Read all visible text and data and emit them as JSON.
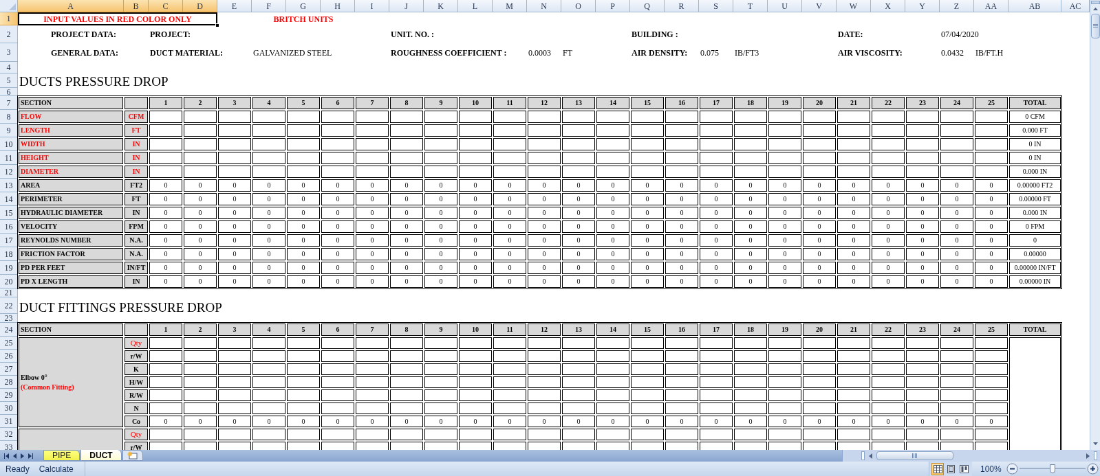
{
  "column_headers": [
    {
      "label": "A",
      "selected": true
    },
    {
      "label": "B",
      "selected": true
    },
    {
      "label": "C",
      "selected": true
    },
    {
      "label": "D",
      "selected": true
    },
    {
      "label": "E",
      "selected": false
    },
    {
      "label": "F",
      "selected": false
    },
    {
      "label": "G",
      "selected": false
    },
    {
      "label": "H",
      "selected": false
    },
    {
      "label": "I",
      "selected": false
    },
    {
      "label": "J",
      "selected": false
    },
    {
      "label": "K",
      "selected": false
    },
    {
      "label": "L",
      "selected": false
    },
    {
      "label": "M",
      "selected": false
    },
    {
      "label": "N",
      "selected": false
    },
    {
      "label": "O",
      "selected": false
    },
    {
      "label": "P",
      "selected": false
    },
    {
      "label": "Q",
      "selected": false
    },
    {
      "label": "R",
      "selected": false
    },
    {
      "label": "S",
      "selected": false
    },
    {
      "label": "T",
      "selected": false
    },
    {
      "label": "U",
      "selected": false
    },
    {
      "label": "V",
      "selected": false
    },
    {
      "label": "W",
      "selected": false
    },
    {
      "label": "X",
      "selected": false
    },
    {
      "label": "Y",
      "selected": false
    },
    {
      "label": "Z",
      "selected": false
    },
    {
      "label": "AA",
      "selected": false
    },
    {
      "label": "AB",
      "selected": false
    },
    {
      "label": "AC",
      "selected": false
    }
  ],
  "row_headers": [
    {
      "label": "1",
      "selected": true
    },
    {
      "label": "2",
      "selected": false
    },
    {
      "label": "3",
      "selected": false
    },
    {
      "label": "4",
      "selected": false
    },
    {
      "label": "5",
      "selected": false
    },
    {
      "label": "6",
      "selected": false
    },
    {
      "label": "7",
      "selected": false
    },
    {
      "label": "8",
      "selected": false
    },
    {
      "label": "9",
      "selected": false
    },
    {
      "label": "10",
      "selected": false
    },
    {
      "label": "11",
      "selected": false
    },
    {
      "label": "12",
      "selected": false
    },
    {
      "label": "13",
      "selected": false
    },
    {
      "label": "14",
      "selected": false
    },
    {
      "label": "15",
      "selected": false
    },
    {
      "label": "16",
      "selected": false
    },
    {
      "label": "17",
      "selected": false
    },
    {
      "label": "18",
      "selected": false
    },
    {
      "label": "19",
      "selected": false
    },
    {
      "label": "20",
      "selected": false
    },
    {
      "label": "21",
      "selected": false
    },
    {
      "label": "22",
      "selected": false
    },
    {
      "label": "23",
      "selected": false
    },
    {
      "label": "24",
      "selected": false
    },
    {
      "label": "25",
      "selected": false
    },
    {
      "label": "26",
      "selected": false
    },
    {
      "label": "27",
      "selected": false
    },
    {
      "label": "28",
      "selected": false
    },
    {
      "label": "29",
      "selected": false
    },
    {
      "label": "30",
      "selected": false
    },
    {
      "label": "31",
      "selected": false
    },
    {
      "label": "32",
      "selected": false
    },
    {
      "label": "33",
      "selected": false
    }
  ],
  "note": "INPUT VALUES IN RED COLOR ONLY",
  "units_label": "BRITCH UNITS",
  "info_rows": [
    {
      "heading": "PROJECT DATA:",
      "fields": [
        {
          "label": "PROJECT:"
        },
        {
          "label": "UNIT. NO. :"
        },
        {
          "label": "BUILDING :"
        },
        {
          "label": "DATE:",
          "value": "07/04/2020"
        }
      ]
    },
    {
      "heading": "GENERAL DATA:",
      "fields": [
        {
          "label": "DUCT MATERIAL:",
          "value": "GALVANIZED STEEL"
        },
        {
          "label": "ROUGHNESS COEFFICIENT :",
          "value": "0.0003",
          "unit": "FT"
        },
        {
          "label": "AIR DENSITY:",
          "value": "0.075",
          "unit": "IB/FT3"
        },
        {
          "label": "AIR VISCOSITY:",
          "value": "0.0432",
          "unit": "IB/FT.H"
        }
      ]
    }
  ],
  "ducts": {
    "title": "DUCTS PRESSURE DROP",
    "section_header": "SECTION",
    "section_numbers": [
      "1",
      "2",
      "3",
      "4",
      "5",
      "6",
      "7",
      "8",
      "9",
      "10",
      "11",
      "12",
      "13",
      "14",
      "15",
      "16",
      "17",
      "18",
      "19",
      "20",
      "21",
      "22",
      "23",
      "24",
      "25"
    ],
    "total_header": "TOTAL",
    "rows": [
      {
        "label": "FLOW",
        "unit": "CFM",
        "kind": "input",
        "total": "0 CFM"
      },
      {
        "label": "LENGTH",
        "unit": "FT",
        "kind": "input",
        "total": "0.000 FT"
      },
      {
        "label": "WIDTH",
        "unit": "IN",
        "kind": "input",
        "total": "0 IN"
      },
      {
        "label": "HEIGHT",
        "unit": "IN",
        "kind": "input",
        "total": "0 IN"
      },
      {
        "label": "DIAMETER",
        "unit": "IN",
        "kind": "input",
        "total": "0.000 IN"
      },
      {
        "label": "AREA",
        "unit": "FT2",
        "kind": "computed",
        "cells": [
          "0",
          "0",
          "0",
          "0",
          "0",
          "0",
          "0",
          "0",
          "0",
          "0",
          "0",
          "0",
          "0",
          "0",
          "0",
          "0",
          "0",
          "0",
          "0",
          "0",
          "0",
          "0",
          "0",
          "0",
          "0"
        ],
        "total": "0.00000 FT2"
      },
      {
        "label": "PERIMETER",
        "unit": "FT",
        "kind": "computed",
        "cells": [
          "0",
          "0",
          "0",
          "0",
          "0",
          "0",
          "0",
          "0",
          "0",
          "0",
          "0",
          "0",
          "0",
          "0",
          "0",
          "0",
          "0",
          "0",
          "0",
          "0",
          "0",
          "0",
          "0",
          "0",
          "0"
        ],
        "total": "0.00000 FT"
      },
      {
        "label": "HYDRAULIC DIAMETER",
        "unit": "IN",
        "kind": "computed",
        "cells": [
          "0",
          "0",
          "0",
          "0",
          "0",
          "0",
          "0",
          "0",
          "0",
          "0",
          "0",
          "0",
          "0",
          "0",
          "0",
          "0",
          "0",
          "0",
          "0",
          "0",
          "0",
          "0",
          "0",
          "0",
          "0"
        ],
        "total": "0.000 IN"
      },
      {
        "label": "VELOCITY",
        "unit": "FPM",
        "kind": "computed",
        "cells": [
          "0",
          "0",
          "0",
          "0",
          "0",
          "0",
          "0",
          "0",
          "0",
          "0",
          "0",
          "0",
          "0",
          "0",
          "0",
          "0",
          "0",
          "0",
          "0",
          "0",
          "0",
          "0",
          "0",
          "0",
          "0"
        ],
        "total": "0 FPM"
      },
      {
        "label": "REYNOLDS NUMBER",
        "unit": "N.A.",
        "kind": "computed",
        "cells": [
          "0",
          "0",
          "0",
          "0",
          "0",
          "0",
          "0",
          "0",
          "0",
          "0",
          "0",
          "0",
          "0",
          "0",
          "0",
          "0",
          "0",
          "0",
          "0",
          "0",
          "0",
          "0",
          "0",
          "0",
          "0"
        ],
        "total": "0"
      },
      {
        "label": "FRICTION FACTOR",
        "unit": "N.A.",
        "kind": "computed",
        "cells": [
          "0",
          "0",
          "0",
          "0",
          "0",
          "0",
          "0",
          "0",
          "0",
          "0",
          "0",
          "0",
          "0",
          "0",
          "0",
          "0",
          "0",
          "0",
          "0",
          "0",
          "0",
          "0",
          "0",
          "0",
          "0"
        ],
        "total": "0.00000"
      },
      {
        "label": "PD PER FEET",
        "unit": "IN/FT",
        "kind": "computed",
        "cells": [
          "0",
          "0",
          "0",
          "0",
          "0",
          "0",
          "0",
          "0",
          "0",
          "0",
          "0",
          "0",
          "0",
          "0",
          "0",
          "0",
          "0",
          "0",
          "0",
          "0",
          "0",
          "0",
          "0",
          "0",
          "0"
        ],
        "total": "0.00000 IN/FT"
      },
      {
        "label": "PD X LENGTH",
        "unit": "IN",
        "kind": "computed",
        "cells": [
          "0",
          "0",
          "0",
          "0",
          "0",
          "0",
          "0",
          "0",
          "0",
          "0",
          "0",
          "0",
          "0",
          "0",
          "0",
          "0",
          "0",
          "0",
          "0",
          "0",
          "0",
          "0",
          "0",
          "0",
          "0"
        ],
        "total": "0.00000 IN"
      }
    ]
  },
  "fittings": {
    "title": "DUCT FITTINGS PRESSURE DROP",
    "section_header": "SECTION",
    "section_numbers": [
      "1",
      "2",
      "3",
      "4",
      "5",
      "6",
      "7",
      "8",
      "9",
      "10",
      "11",
      "12",
      "13",
      "14",
      "15",
      "16",
      "17",
      "18",
      "19",
      "20",
      "21",
      "22",
      "23",
      "24",
      "25"
    ],
    "total_header": "TOTAL",
    "groups": [
      {
        "name": "Elbow 0°",
        "note": "(Common Fitting)",
        "params": [
          {
            "label": "Qty",
            "kind": "input"
          },
          {
            "label": "r/W",
            "kind": "parameter"
          },
          {
            "label": "K",
            "kind": "parameter"
          },
          {
            "label": "H/W",
            "kind": "parameter"
          },
          {
            "label": "R/W",
            "kind": "parameter"
          },
          {
            "label": "N",
            "kind": "parameter"
          },
          {
            "label": "Co",
            "kind": "computed",
            "cells": [
              "0",
              "0",
              "0",
              "0",
              "0",
              "0",
              "0",
              "0",
              "0",
              "0",
              "0",
              "0",
              "0",
              "0",
              "0",
              "0",
              "0",
              "0",
              "0",
              "0",
              "0",
              "0",
              "0",
              "0",
              "0"
            ]
          }
        ]
      },
      {
        "params": [
          {
            "label": "Qty",
            "kind": "input"
          },
          {
            "label": "r/W",
            "kind": "parameter"
          }
        ]
      }
    ]
  },
  "sheet_tabs": [
    {
      "label": "PIPE",
      "selected": false
    },
    {
      "label": "DUCT",
      "selected": true
    }
  ],
  "status_bar": {
    "items": [
      "Ready",
      "Calculate"
    ],
    "view_buttons": [
      {
        "kind": "normal",
        "selected": true
      },
      {
        "kind": "page-layout",
        "selected": false
      },
      {
        "kind": "page-break",
        "selected": false
      }
    ],
    "zoom": "100%",
    "zoom_slider": {
      "level": 0.5
    }
  }
}
